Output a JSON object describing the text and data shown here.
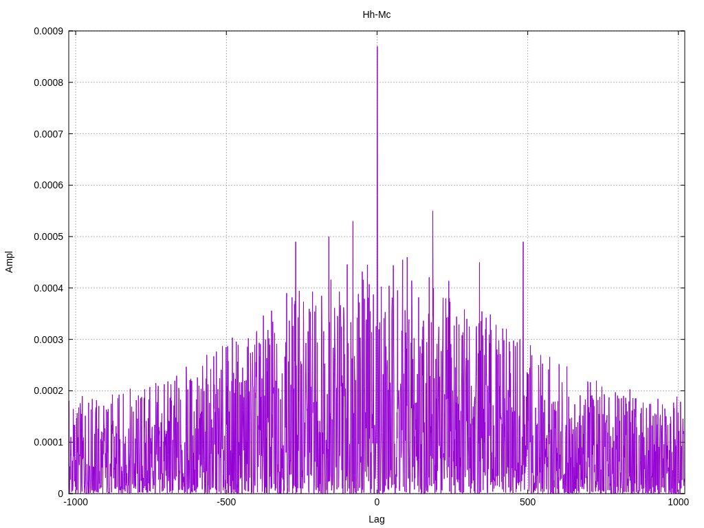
{
  "chart": {
    "title": "Hh-Mc",
    "xlabel": "Lag",
    "ylabel": "Ampl",
    "xticks": [
      "-1000",
      "-500",
      "0",
      "500",
      "1000"
    ],
    "yticks": [
      "0.0009",
      "0.0008",
      "0.0007",
      "0.0006",
      "0.0005",
      "0.0004",
      "0.0003",
      "0.0002",
      "0.0001",
      "0"
    ]
  }
}
